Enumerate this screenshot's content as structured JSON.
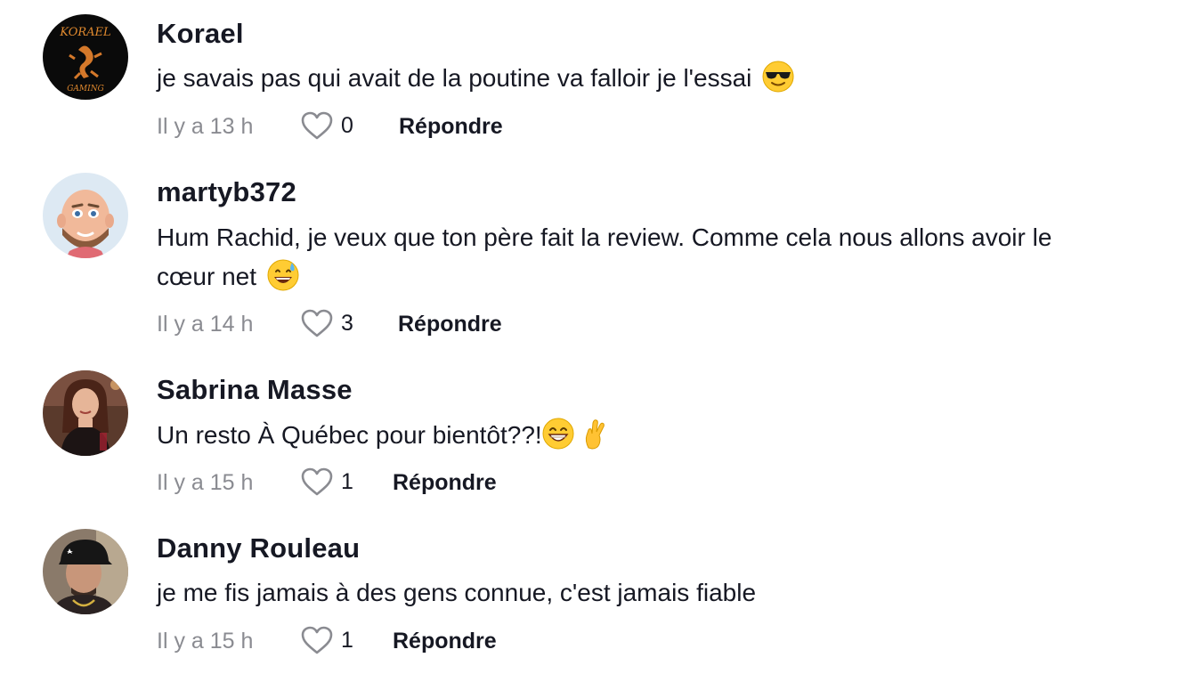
{
  "comments": [
    {
      "username": "Korael",
      "avatar_text_top": "KORAEL",
      "avatar_text_bottom": "GAMING",
      "text": "je savais pas qui avait de la poutine va falloir je l'essai",
      "emojis": [
        "smiling-face-with-sunglasses"
      ],
      "time": "Il y a 13 h",
      "likes": "0",
      "reply_label": "Répondre"
    },
    {
      "username": "martyb372",
      "text_line1": "Hum Rachid, je veux que ton père fait la review. Comme cela nous allons avoir le",
      "text_line2": "cœur net",
      "emojis": [
        "grinning-face-with-sweat"
      ],
      "time": "Il y a 14 h",
      "likes": "3",
      "reply_label": "Répondre"
    },
    {
      "username": "Sabrina Masse",
      "text": "Un resto À Québec pour bientôt??!",
      "emojis": [
        "beaming-face",
        "crossed-fingers"
      ],
      "time": "Il y a 15 h",
      "likes": "1",
      "reply_label": "Répondre"
    },
    {
      "username": "Danny Rouleau",
      "text": "je me fis jamais à des gens connue, c'est jamais fiable",
      "time": "Il y a 15 h",
      "likes": "1",
      "reply_label": "Répondre"
    }
  ],
  "colors": {
    "text": "#161823",
    "muted": "#8a8b91",
    "background": "#ffffff"
  },
  "icons": {
    "like": "heart-outline-icon"
  }
}
